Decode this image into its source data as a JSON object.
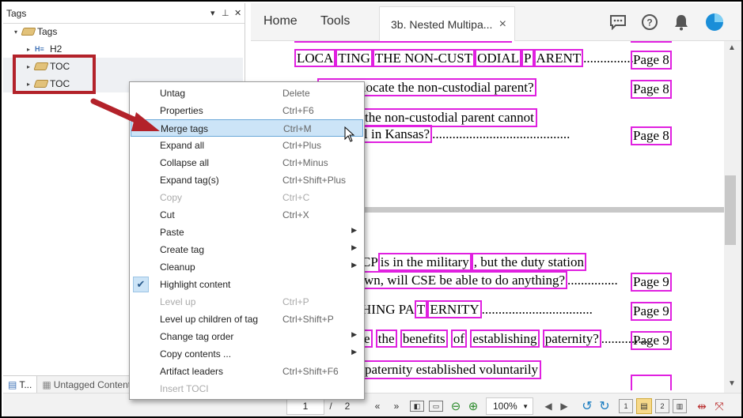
{
  "tags_panel": {
    "title": "Tags",
    "header_controls": [
      "▾",
      "⊥",
      "✕"
    ],
    "tree": [
      {
        "label": "Tags",
        "icon": "tag-icon",
        "expander": "▾"
      },
      {
        "label": "H2",
        "icon": "heading-icon",
        "expander": "▸"
      },
      {
        "label": "TOC",
        "icon": "tag-icon",
        "expander": "▸"
      },
      {
        "label": "TOC",
        "icon": "tag-icon",
        "expander": "▸"
      }
    ],
    "bottom_tabs": [
      "T...",
      "Untagged Content"
    ]
  },
  "topbar": {
    "home": "Home",
    "tools": "Tools",
    "doc_tab": "3b. Nested Multipa...",
    "doc_tab_close": "×"
  },
  "document": {
    "line1": "LOCATING THE NON-CUSTODIAL PARENT",
    "line1_parts": [
      "LOCA",
      "TING",
      "THE NON-CUST",
      "ODIAL",
      "P",
      "ARENT"
    ],
    "dots1": "...............",
    "page1": "Page 8",
    "line2": "es CSE locate the non-custodial parent?",
    "page2": "Page 8",
    "line3a": "the non-custodial parent cannot",
    "line3b": "l in Kansas?",
    "dots3": ".........................................",
    "page3": "Page 8",
    "line4a_pre": "CP",
    "line4a": "is in the military",
    "line4a_post": ", but the duty station",
    "line4b": "wn, will CSE be able to do anything?",
    "dots4": "...............",
    "page4": "Page 9",
    "line5": "HING PA",
    "line5b": "T",
    "line5c": "ERNITY",
    "dots5": ".................................",
    "page5": "Page 9",
    "line6_words": [
      "e",
      "the",
      "benefits",
      "of",
      "establishing",
      "paternity?"
    ],
    "dots6": "...............",
    "page6": "Page 9",
    "line7": "paternity established voluntarily"
  },
  "context_menu": {
    "items": [
      {
        "label": "Untag",
        "shortcut": "Delete"
      },
      {
        "label": "Properties",
        "shortcut": "Ctrl+F6"
      },
      {
        "label": "Merge tags",
        "shortcut": "Ctrl+M",
        "highlighted": true
      },
      {
        "label": "Expand all",
        "shortcut": "Ctrl+Plus"
      },
      {
        "label": "Collapse all",
        "shortcut": "Ctrl+Minus"
      },
      {
        "label": "Expand tag(s)",
        "shortcut": "Ctrl+Shift+Plus"
      },
      {
        "label": "Copy",
        "shortcut": "Ctrl+C",
        "disabled": true
      },
      {
        "label": "Cut",
        "shortcut": "Ctrl+X"
      },
      {
        "label": "Paste",
        "shortcut": "",
        "submenu": true
      },
      {
        "label": "Create tag",
        "shortcut": "",
        "submenu": true
      },
      {
        "label": "Cleanup",
        "shortcut": "",
        "submenu": true
      },
      {
        "label": "Highlight content",
        "shortcut": "",
        "checked": true
      },
      {
        "label": "Level up",
        "shortcut": "Ctrl+P",
        "disabled": true
      },
      {
        "label": "Level up children of tag",
        "shortcut": "Ctrl+Shift+P"
      },
      {
        "label": "Change tag order",
        "shortcut": "",
        "submenu": true
      },
      {
        "label": "Copy contents ...",
        "shortcut": "",
        "submenu": true
      },
      {
        "label": "Artifact leaders",
        "shortcut": "Ctrl+Shift+F6"
      },
      {
        "label": "Insert TOCI",
        "shortcut": "",
        "disabled": true
      }
    ]
  },
  "statusbar": {
    "page_current": "1",
    "page_separator": "/",
    "page_total": "2",
    "zoom": "100%"
  },
  "colors": {
    "highlight_box": "#e020e0",
    "annotation_red": "#b3222a",
    "menu_highlight": "#cce4f7",
    "accent_blue": "#1a8ed8"
  }
}
